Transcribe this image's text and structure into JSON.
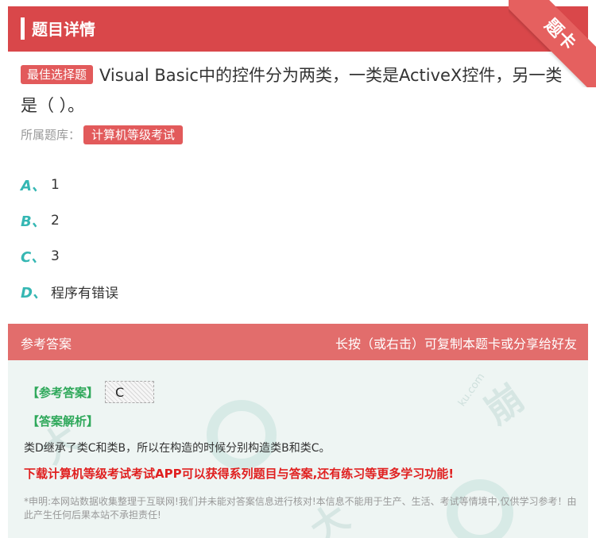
{
  "header": {
    "title": "题目详情",
    "corner_label": "题卡"
  },
  "question": {
    "type_tag": "最佳选择题",
    "text": "Visual Basic中的控件分为两类，一类是ActiveX控件，另一类是（   ）。",
    "bank_label": "所属题库：",
    "bank_name": "计算机等级考试"
  },
  "options": [
    {
      "letter": "A、",
      "text": "1"
    },
    {
      "letter": "B、",
      "text": "2"
    },
    {
      "letter": "C、",
      "text": "3"
    },
    {
      "letter": "D、",
      "text": "程序有错误"
    }
  ],
  "answer": {
    "section_title": "参考答案",
    "hint": "长按（或右击）可复制本题卡或分享给好友",
    "ref_label": "【参考答案】",
    "ref_value": "C",
    "analysis_label": "【答案解析】",
    "analysis": "类D继承了类C和类B，所以在构造的时候分别构造类B和类C。",
    "promo": "下载计算机等级考试考试APP可以获得系列题目与答案,还有练习等更多学习功能!",
    "disclaimer": "*申明:本网站数据收集整理于互联网!我们并未能对答案信息进行核对!本信息不能用于生产、生活、考试等情境中,仅供学习参考！由此产生任何后果本站不承担责任!"
  },
  "colors": {
    "header": "#d9474a",
    "accent_teal": "#35b7b3",
    "answer_green": "#2ea85a",
    "promo_red": "#e02020"
  }
}
